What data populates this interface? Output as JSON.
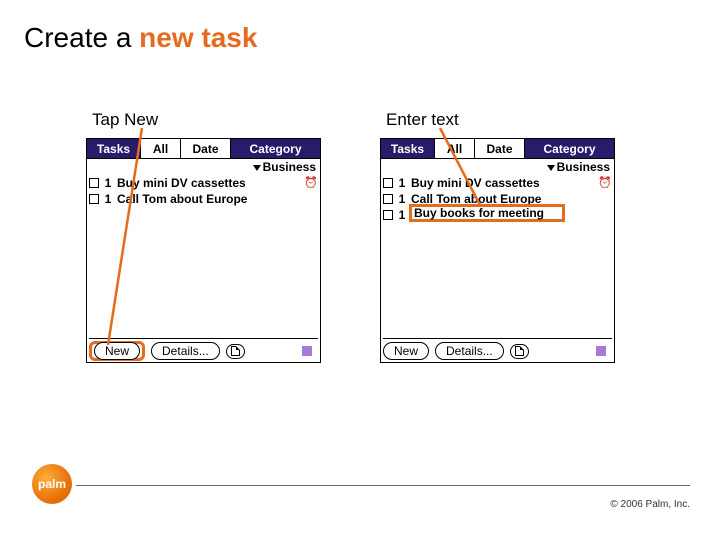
{
  "slide": {
    "title_pre": "Create a ",
    "title_emph": "new task"
  },
  "captions": {
    "left": "Tap New",
    "right": "Enter text"
  },
  "panel_header": {
    "tasks": "Tasks",
    "all": "All",
    "date": "Date",
    "category": "Category"
  },
  "filter_label": "Business",
  "panel_left": {
    "tasks": [
      {
        "priority": "1",
        "text": "Buy mini DV cassettes",
        "alarm": true
      },
      {
        "priority": "1",
        "text": "Call Tom about Europe",
        "alarm": false
      }
    ]
  },
  "panel_right": {
    "tasks": [
      {
        "priority": "1",
        "text": "Buy mini DV cassettes",
        "alarm": true
      },
      {
        "priority": "1",
        "text": "Call Tom about Europe",
        "alarm": false
      }
    ],
    "new_task": {
      "priority": "1",
      "text": "Buy books for meeting"
    }
  },
  "footer_buttons": {
    "new": "New",
    "details": "Details..."
  },
  "brand": {
    "logo_text": "palm",
    "copyright": "© 2006 Palm, Inc."
  }
}
